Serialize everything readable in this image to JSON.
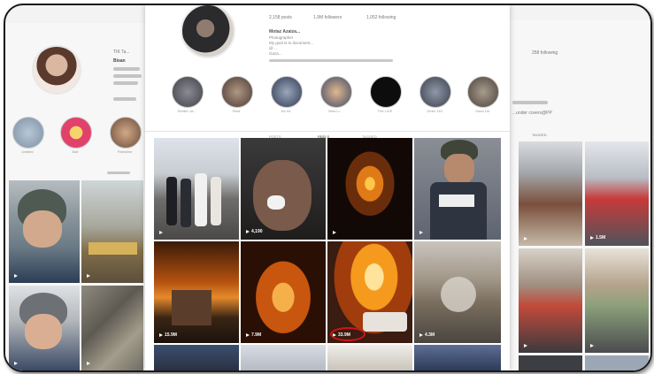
{
  "left_profile": {
    "username": "TIK Ta...",
    "display_name": "Bisan",
    "bio_lines": [
      "@ ...",
      "@ ...",
      "@ ..."
    ],
    "highlights": [
      {
        "label": "Untitled",
        "icon": "photo-icon"
      },
      {
        "label": "Ball",
        "icon": "emoji-icon"
      },
      {
        "label": "Palestine",
        "icon": "person-icon"
      }
    ],
    "tiles": [
      {
        "views": "",
        "icon": "play-icon"
      },
      {
        "views": "",
        "icon": "play-icon"
      },
      {
        "views": "",
        "icon": "play-icon"
      },
      {
        "views": "",
        "icon": "play-icon"
      }
    ]
  },
  "center_profile": {
    "stats": {
      "posts": "2,158 posts",
      "followers": "1.9M followers",
      "following": "1,052 following"
    },
    "name": "Motaz Azaiza...",
    "bio_lines": [
      "Photographer",
      "My goal is to document...",
      "@ ...",
      "Gaza..."
    ],
    "highlights": [
      "Sheikh Ja...",
      "Rest",
      "No 04",
      "Wea Li...",
      "The LIVE",
      "Omer 140",
      "Gaza 1st"
    ],
    "tabs": [
      "POSTS",
      "REELS",
      "TAGGED"
    ],
    "tiles": [
      {
        "views": "",
        "tone": "street"
      },
      {
        "views": "4,190",
        "tone": "face"
      },
      {
        "views": "",
        "tone": "explosion-night"
      },
      {
        "views": "",
        "tone": "press"
      },
      {
        "views": "15.9M",
        "tone": "fire-city"
      },
      {
        "views": "7.9M",
        "tone": "fire-glow"
      },
      {
        "views": "33.9M",
        "tone": "blast",
        "circled": true
      },
      {
        "views": "4.3M",
        "tone": "smoke"
      },
      {
        "views": "",
        "tone": "street-blue"
      },
      {
        "views": "",
        "tone": "pale"
      },
      {
        "views": "",
        "tone": "sky"
      },
      {
        "views": "",
        "tone": "blue"
      }
    ]
  },
  "right_profile": {
    "following": "258 following",
    "bio_fragment": "...under covers@PP",
    "tab_fragment": "TAGGED",
    "tiles": [
      {
        "views": "",
        "tone": "kids"
      },
      {
        "views": "1.5M",
        "tone": "rescue"
      },
      {
        "views": "",
        "tone": "crowd"
      },
      {
        "views": "",
        "tone": "carry"
      },
      {
        "views": "",
        "tone": "dark"
      },
      {
        "views": "",
        "tone": "bright"
      }
    ]
  },
  "colors": {
    "highlight_ring": "#d3121b",
    "frame": "#1a1a1a"
  }
}
